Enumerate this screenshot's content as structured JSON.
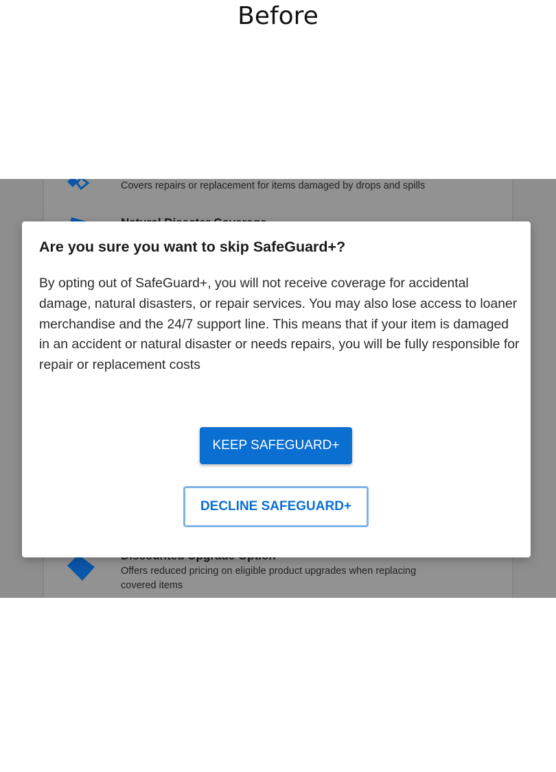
{
  "caption": "Before",
  "background": {
    "features": [
      {
        "title": "",
        "description": "Covers repairs or replacement for items damaged by drops and spills",
        "icon": "damage-icon"
      },
      {
        "title": "Natural Disaster Coverage",
        "description": "",
        "icon": "disaster-icon"
      },
      {
        "title": "Discounted Upgrade Option",
        "description": "Offers reduced pricing on eligible product upgrades when replacing covered items",
        "icon": "upgrade-tag-icon"
      }
    ]
  },
  "modal": {
    "title": "Are you sure you want to skip SafeGuard+?",
    "body": "By opting out of SafeGuard+, you will not receive coverage for accidental damage, natural disasters, or repair services. You may also lose access to loaner merchandise and the 24/7 support line. This means that if your item is damaged in an accident or natural disaster or needs repairs, you will be fully responsible for repair or replacement costs",
    "keep_label": "KEEP SAFEGUARD+",
    "decline_label": "DECLINE SAFEGUARD+"
  },
  "colors": {
    "primary": "#0a6fd1",
    "overlay": "#8e8e8e",
    "decline_border": "#7fb3e8"
  }
}
